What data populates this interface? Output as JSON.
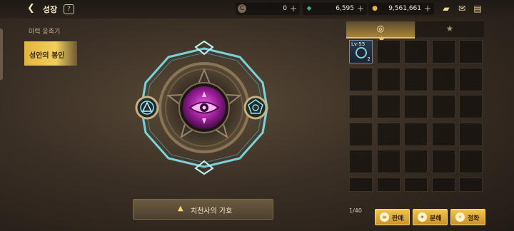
{
  "header": {
    "title": "성장",
    "help_label": "?",
    "back_icon": "back-arrow-icon",
    "currencies": [
      {
        "name": "crystal",
        "icon": "crystal-icon",
        "glyph": "C",
        "value": "0",
        "color": "#7a6a55"
      },
      {
        "name": "gem",
        "icon": "green-gem-icon",
        "glyph": "◆",
        "value": "6,595",
        "color": "#3fae7e"
      },
      {
        "name": "gold",
        "icon": "gold-coin-icon",
        "glyph": "●",
        "value": "9,561,661",
        "color": "#e4b441"
      }
    ],
    "plus_label": "+",
    "right_icons": [
      "treasure-chest-icon",
      "mail-icon",
      "chat-icon"
    ]
  },
  "sidebar": {
    "section_title": "마력 응축기",
    "items": [
      {
        "label": "성안의 봉인",
        "selected": true
      }
    ]
  },
  "main": {
    "bottom_button_label": "치천사의 가호"
  },
  "inventory": {
    "tabs": [
      {
        "icon": "gear-ring-icon",
        "glyph": "◎",
        "active": true
      },
      {
        "icon": "star-icon",
        "glyph": "★",
        "active": false
      }
    ],
    "items": [
      {
        "level": "Lv-55",
        "count": "2",
        "icon": "rune-ring-icon"
      }
    ],
    "capacity": "1/40",
    "actions": [
      {
        "label": "판매",
        "icon": "coins-icon",
        "glyph": "≡"
      },
      {
        "label": "분해",
        "icon": "disassemble-icon",
        "glyph": "✦"
      },
      {
        "label": "정화",
        "icon": "purify-icon",
        "glyph": "✧"
      }
    ]
  },
  "colors": {
    "accent_gold": "#e8c25c",
    "rune_cyan": "#7fe3ee",
    "eye_magenta": "#d640c8"
  }
}
